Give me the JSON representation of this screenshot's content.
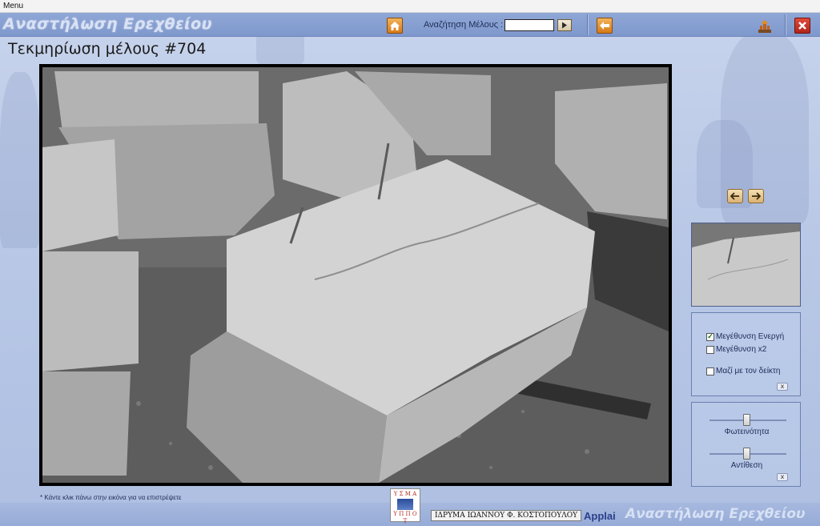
{
  "menubar": {
    "label": "Menu"
  },
  "header": {
    "app_title": "Αναστήλωση Ερεχθείου",
    "search_label": "Αναζήτηση Μέλους :",
    "search_value": "",
    "icons": {
      "home": "home-icon",
      "search_go": "play-arrow-icon",
      "back": "back-arrow-icon",
      "worker": "worker-icon",
      "close": "close-icon"
    }
  },
  "page": {
    "heading": "Τεκμηρίωση μέλους #704"
  },
  "navigation": {
    "prev_icon": "arrow-left-icon",
    "next_icon": "arrow-right-icon"
  },
  "zoom_panel": {
    "options": [
      {
        "label": "Μεγέθυνση Ενεργή",
        "checked": true
      },
      {
        "label": "Μεγέθυνση x2",
        "checked": false
      },
      {
        "label": "Μαζί με τον δείκτη",
        "checked": false
      }
    ],
    "close_label": "x"
  },
  "adjust_panel": {
    "brightness_label": "Φωτεινότητα",
    "brightness_value": 0.5,
    "contrast_label": "Αντίθεση",
    "contrast_value": 0.5,
    "close_label": "x"
  },
  "footer": {
    "hint": "* Κάντε κλικ πάνω στην εικόνα για να επιστρέψετε",
    "logo_top": "Υ Σ Μ Α",
    "logo_bottom": "Υ Π Π Ο Τ",
    "foundation": "ΙΔΡΥΜΑ ΙΩΑΝΝΟΥ Φ. ΚΟΣΤΟΠΟΥΛΟΥ",
    "credit": "Applai",
    "footer_title": "Αναστήλωση Ερεχθείου"
  }
}
